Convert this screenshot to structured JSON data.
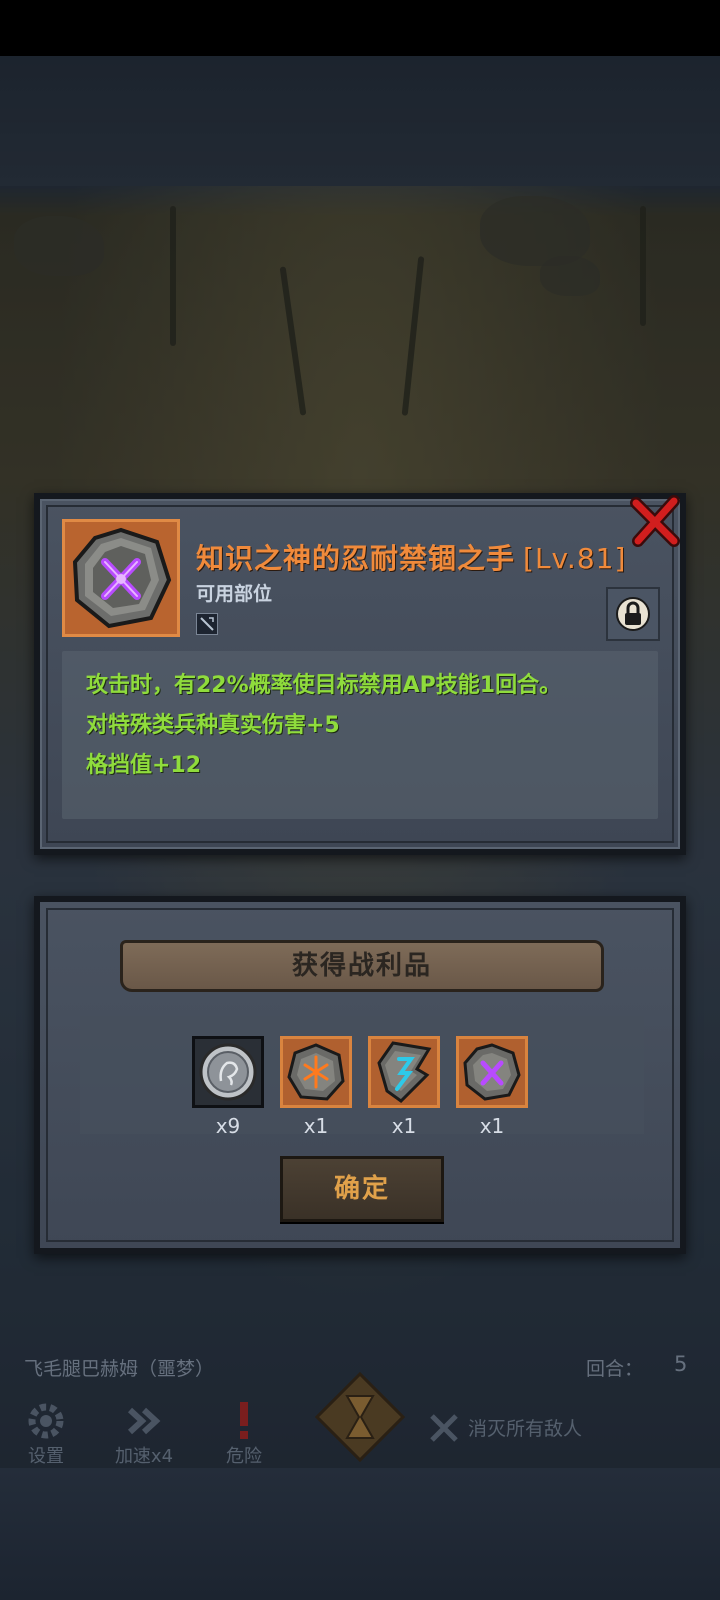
{
  "item": {
    "name": "知识之神的忍耐禁锢之手",
    "level": "[Lv.81]",
    "slot_label": "可用部位",
    "rune_color": "#9b3bff",
    "effects": [
      "攻击时，有22%概率使目标禁用AP技能1回合。",
      "对特殊类兵种真实伤害+5",
      "格挡值+12"
    ]
  },
  "loot": {
    "title": "获得战利品",
    "items": [
      {
        "icon": "silver-coin-icon",
        "qty": "x9"
      },
      {
        "icon": "orange-rune-stone-icon",
        "qty": "x1"
      },
      {
        "icon": "cyan-rune-shard-icon",
        "qty": "x1"
      },
      {
        "icon": "purple-rune-stone-icon",
        "qty": "x1"
      }
    ],
    "confirm_label": "确定"
  },
  "hud": {
    "stage_name": "飞毛腿巴赫姆（噩梦）",
    "round_label": "回合：",
    "round_value": "5",
    "settings_label": "设置",
    "speed_label": "加速x4",
    "danger_label": "危险",
    "objective": "消灭所有敌人"
  },
  "colors": {
    "title_orange": "#f08a3b",
    "effect_green": "#8fdc3c",
    "close_red": "#d21e1e"
  }
}
